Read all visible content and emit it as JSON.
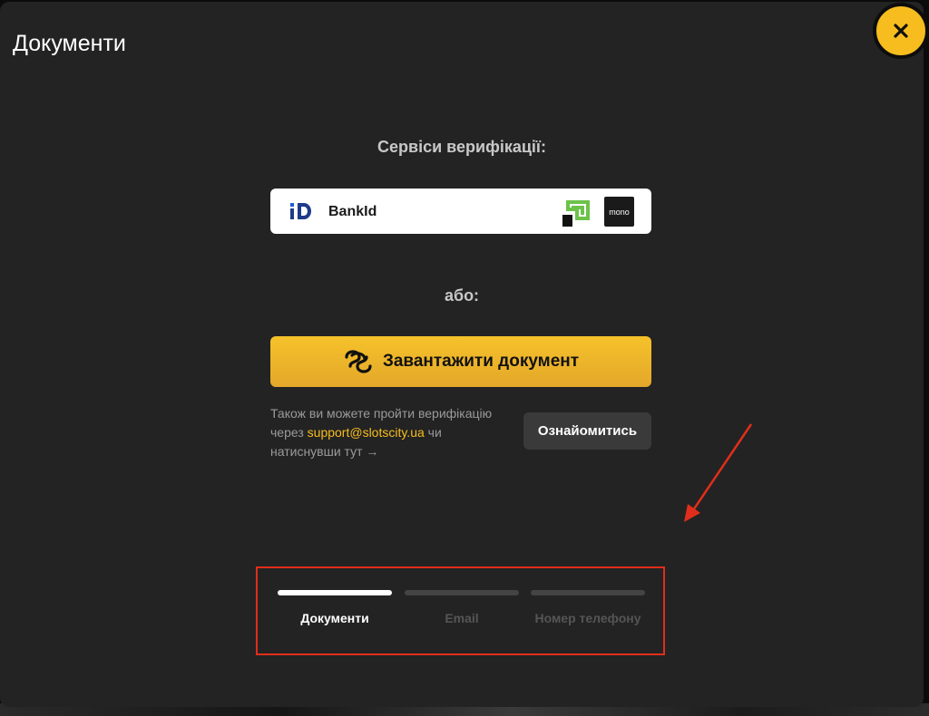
{
  "modal": {
    "title": "Документи",
    "close_icon": "close-icon"
  },
  "verification": {
    "services_title": "Сервіси верифікації:",
    "bankid": {
      "label": "BankId",
      "logos": [
        "bankid-icon",
        "privatbank-icon",
        "mono-icon"
      ],
      "mono_text": "mono"
    },
    "or_text": "або:",
    "upload_button": {
      "label": "Завантажити документ",
      "icon": "diia-icon"
    },
    "info": {
      "line1": "Також ви можете пройти верифікацію",
      "via": "через",
      "email": "support@slotscity.ua",
      "after_email": "чи",
      "line3": "натиснувши тут →"
    },
    "learn_button": "Ознайомитись"
  },
  "steps": [
    {
      "label": "Документи",
      "active": true
    },
    {
      "label": "Email",
      "active": false
    },
    {
      "label": "Номер телефону",
      "active": false
    }
  ],
  "colors": {
    "accent": "#f7bd1e",
    "modal_bg": "#232323",
    "highlight": "#e02e1c"
  }
}
